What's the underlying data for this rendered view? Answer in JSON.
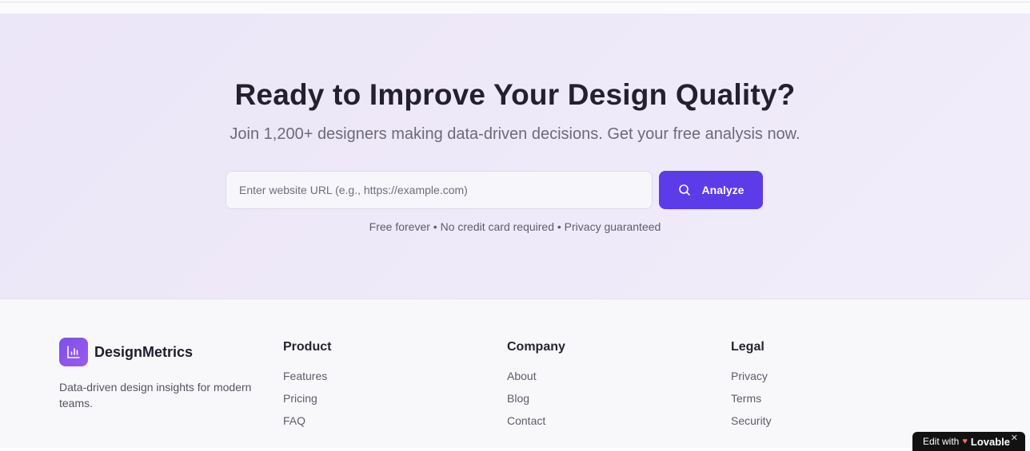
{
  "cta": {
    "title": "Ready to Improve Your Design Quality?",
    "subtitle": "Join 1,200+ designers making data-driven decisions. Get your free analysis now.",
    "input_placeholder": "Enter website URL (e.g., https://example.com)",
    "input_value": "",
    "button_label": "Analyze",
    "button_icon": "search-icon",
    "note": "Free forever • No credit card required • Privacy guaranteed",
    "accent_color": "#5b3ce8"
  },
  "footer": {
    "brand": {
      "name": "DesignMetrics",
      "icon": "bar-chart-icon",
      "description": "Data-driven design insights for modern teams."
    },
    "columns": [
      {
        "heading": "Product",
        "links": [
          "Features",
          "Pricing",
          "FAQ"
        ]
      },
      {
        "heading": "Company",
        "links": [
          "About",
          "Blog",
          "Contact"
        ]
      },
      {
        "heading": "Legal",
        "links": [
          "Privacy",
          "Terms",
          "Security"
        ]
      }
    ]
  },
  "badge": {
    "prefix": "Edit with",
    "brand": "Lovable",
    "close": "✕"
  }
}
